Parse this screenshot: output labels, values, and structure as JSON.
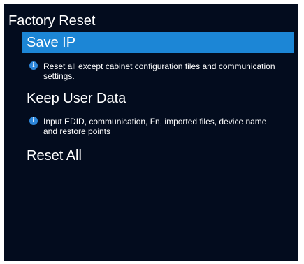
{
  "page": {
    "title": "Factory Reset"
  },
  "menu": {
    "save_ip": {
      "label": "Save IP",
      "selected": true,
      "info": "Reset all except cabinet configuration files and communication settings."
    },
    "keep_user_data": {
      "label": "Keep User Data",
      "info": "Input EDID, communication, Fn, imported files, device name and restore points"
    },
    "reset_all": {
      "label": "Reset All"
    }
  },
  "icons": {
    "info": "info-icon",
    "info_glyph": "i"
  },
  "colors": {
    "background": "#030c1e",
    "selection": "#1c86d6",
    "info_icon": "#2d86d9",
    "text": "#ffffff"
  }
}
